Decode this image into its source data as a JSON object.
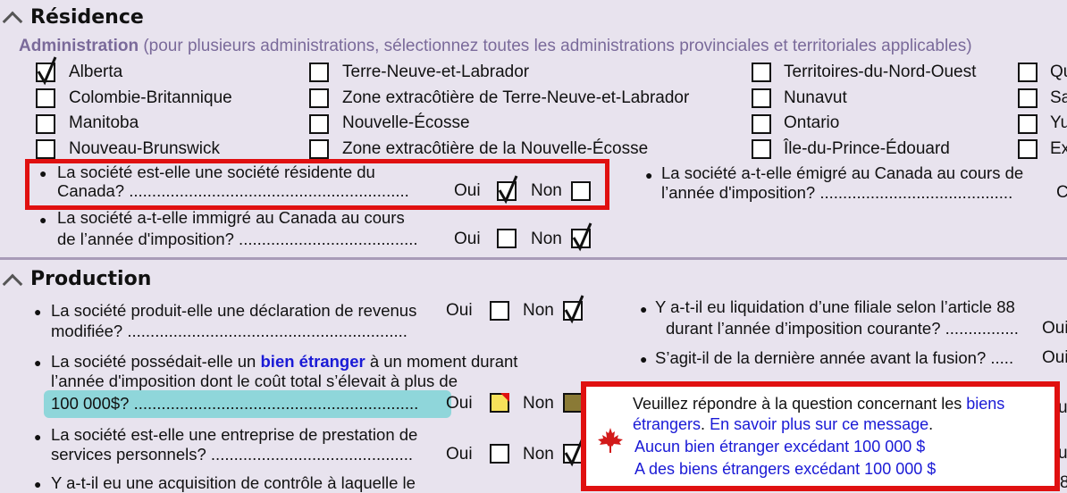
{
  "residence": {
    "title": "Résidence",
    "admin_label": "Administration",
    "admin_hint": "(pour plusieurs administrations, sélectionnez toutes les administrations provinciales et territoriales applicables)",
    "col1": [
      "Alberta",
      "Colombie-Britannique",
      "Manitoba",
      "Nouveau-Brunswick"
    ],
    "col2": [
      "Terre-Neuve-et-Labrador",
      "Zone extracôtière de Terre-Neuve-et-Labrador",
      "Nouvelle-Écosse",
      "Zone extracôtière de la Nouvelle-Écosse"
    ],
    "col3": [
      "Territoires-du-Nord-Ouest",
      "Nunavut",
      "Ontario",
      "Île-du-Prince-Édouard"
    ],
    "col4": [
      "Qu",
      "Sa",
      "Yu",
      "Ex"
    ],
    "q_resident_l1": "La société est-elle une société résidente du",
    "q_resident_l2": "Canada? .............................................................",
    "q_immigrated_l1": "La société a-t-elle immigré au Canada au cours",
    "q_immigrated_l2": "de l’année d'imposition? .......................................",
    "q_emigrated_l1": "La société a-t-elle émigré au Canada au cours de",
    "q_emigrated_l2": "l’année d'imposition? ..........................................",
    "q_emigrated_cut": "C"
  },
  "production": {
    "title": "Production",
    "q_amended_l1": "La société produit-elle une déclaration de revenus",
    "q_amended_l2": "modifiée? .............................................................",
    "q_foreign_l1a": "La société possédait-elle un",
    "q_foreign_link": "bien étranger",
    "q_foreign_l1b": "à un moment durant",
    "q_foreign_l2": "l’année d'imposition dont le coût total s’élevait à plus de",
    "q_foreign_l3": "100 000$? ..............................................................",
    "q_psb_l1": "La société est-elle une entreprise de prestation de",
    "q_psb_l2": "services personnels? ............................................",
    "q_control_l1": "Y a-t-il eu une acquisition de contrôle à laquelle le",
    "q_liquidation_l1": "Y a-t-il eu liquidation d’une filiale selon l’article 88",
    "q_liquidation_l2": "durant l’année d’imposition courante? ................",
    "q_liquidation_cut": "Oui",
    "q_lastyear": "S’agit-il de la dernière année avant la fusion? .....",
    "q_lastyear_cut": "Oui",
    "cut_right_1": "ui",
    "cut_right_2": "ui",
    "cut_right_3": "8"
  },
  "labels": {
    "oui": "Oui",
    "non": "Non"
  },
  "popup": {
    "msg_a": "Veuillez répondre à la question concernant les",
    "msg_link": "biens",
    "msg_link2": "étrangers",
    "msg_b": ". ",
    "msg_more": "En savoir plus sur ce message",
    "msg_end": ".",
    "option1": "Aucun bien étranger excédant 100 000 $",
    "option2": "A des biens étrangers excédant 100 000 $"
  },
  "colors": {
    "error_red": "#e01010",
    "link_blue": "#1a1ad6",
    "highlight": "#8fd6da",
    "background": "#e8e3ee"
  },
  "icons": [
    "collapse-caret-icon",
    "checkmark-icon",
    "maple-leaf-icon",
    "error-flag-icon"
  ]
}
